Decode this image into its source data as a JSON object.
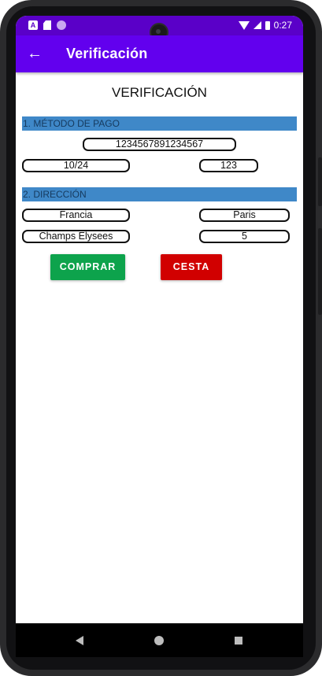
{
  "status_bar": {
    "time": "0:27",
    "notification_icons": [
      "font-download-icon",
      "sd-card-icon",
      "purple-dot-icon"
    ],
    "system_icons": [
      "wifi-icon",
      "signal-icon",
      "battery-icon"
    ]
  },
  "app_bar": {
    "back_icon": "arrow-left-icon",
    "back_glyph": "←",
    "title": "Verificación"
  },
  "page": {
    "heading": "VERIFICACIÓN"
  },
  "payment": {
    "section_label": "1. MÉTODO DE PAGO",
    "card_number": "1234567891234567",
    "expiry": "10/24",
    "cvv": "123"
  },
  "address": {
    "section_label": "2. DIRECCIÓN",
    "country": "Francia",
    "city": "Paris",
    "street": "Champs Elysees",
    "number": "5"
  },
  "actions": {
    "buy_label": "COMPRAR",
    "cart_label": "CESTA"
  },
  "navigation": {
    "icons": [
      "nav-back-icon",
      "nav-home-icon",
      "nav-recents-icon"
    ]
  },
  "colors": {
    "status_bar": "#5a00c8",
    "app_bar": "#6200ee",
    "section_bar": "#3f88c8",
    "buy_button": "#0da34c",
    "cart_button": "#d10000"
  }
}
